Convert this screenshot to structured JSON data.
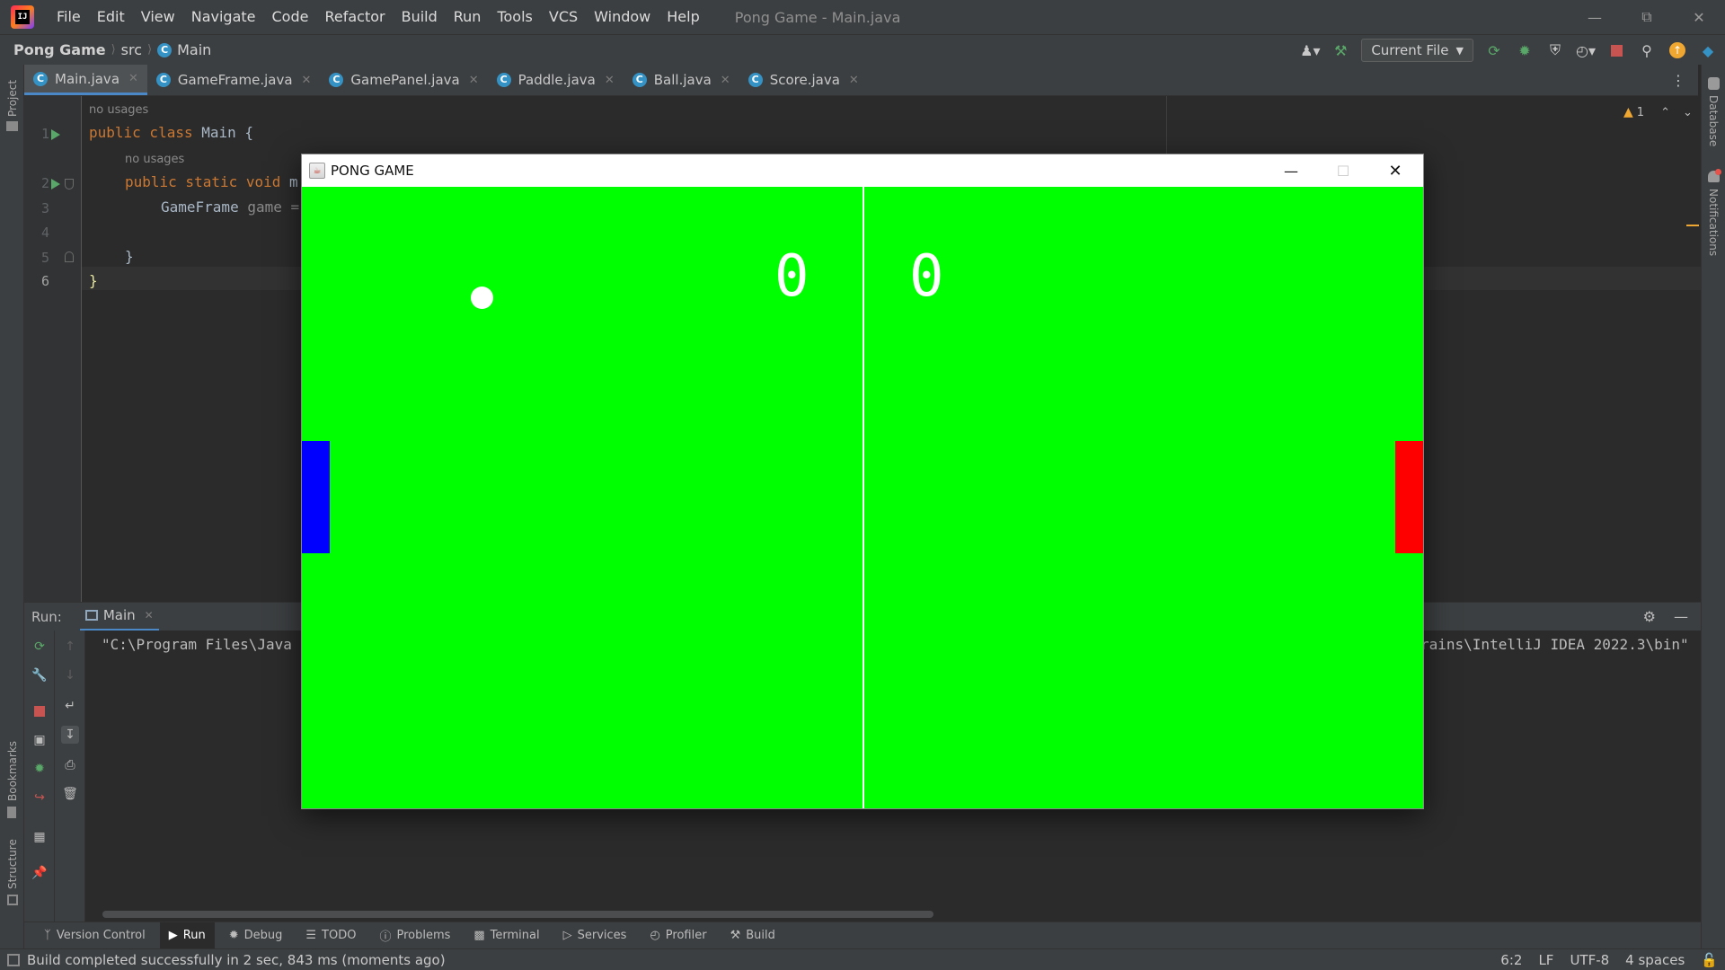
{
  "titlebar": {
    "menu": [
      "File",
      "Edit",
      "View",
      "Navigate",
      "Code",
      "Refactor",
      "Build",
      "Run",
      "Tools",
      "VCS",
      "Window",
      "Help"
    ],
    "window_title": "Pong Game - Main.java"
  },
  "navbar": {
    "project": "Pong Game",
    "folder": "src",
    "class": "Main",
    "run_config": "Current File"
  },
  "tabs": [
    {
      "label": "Main.java",
      "active": true
    },
    {
      "label": "GameFrame.java",
      "active": false
    },
    {
      "label": "GamePanel.java",
      "active": false
    },
    {
      "label": "Paddle.java",
      "active": false
    },
    {
      "label": "Ball.java",
      "active": false
    },
    {
      "label": "Score.java",
      "active": false
    }
  ],
  "side_labels": {
    "project": "Project",
    "bookmarks": "Bookmarks",
    "structure": "Structure",
    "database": "Database",
    "notifications": "Notifications"
  },
  "editor": {
    "hint_class": "no usages",
    "hint_method": "no usages",
    "line_numbers": [
      "1",
      "2",
      "3",
      "4",
      "5",
      "6"
    ],
    "warning_count": "1",
    "lines": {
      "l1_kw": "public class",
      "l1_rest": " Main {",
      "l2_kw": "public static void",
      "l2_rest": " m",
      "l3_type": "GameFrame",
      "l3_rest": " game =",
      "l5": "}",
      "l6": "}"
    }
  },
  "run_panel": {
    "label": "Run:",
    "tab": "Main",
    "console_left": "\"C:\\Program Files\\Java",
    "console_right": "rains\\IntelliJ IDEA 2022.3\\bin\""
  },
  "bottom_tabs": [
    {
      "label": "Version Control",
      "icon": "branch-icon",
      "active": false
    },
    {
      "label": "Run",
      "icon": "play-icon",
      "active": true
    },
    {
      "label": "Debug",
      "icon": "bug-icon",
      "active": false
    },
    {
      "label": "TODO",
      "icon": "list-icon",
      "active": false
    },
    {
      "label": "Problems",
      "icon": "info-icon",
      "active": false
    },
    {
      "label": "Terminal",
      "icon": "terminal-icon",
      "active": false
    },
    {
      "label": "Services",
      "icon": "services-icon",
      "active": false
    },
    {
      "label": "Profiler",
      "icon": "profiler-icon",
      "active": false
    },
    {
      "label": "Build",
      "icon": "hammer-icon",
      "active": false
    }
  ],
  "statusbar": {
    "message": "Build completed successfully in 2 sec, 843 ms (moments ago)",
    "position": "6:2",
    "line_sep": "LF",
    "encoding": "UTF-8",
    "indent": "4 spaces"
  },
  "pong": {
    "title": "PONG GAME",
    "score_left": "0",
    "score_right": "0",
    "colors": {
      "field": "#00ff00",
      "left_paddle": "#0000ff",
      "right_paddle": "#ff0000",
      "ball": "#ffffff"
    }
  },
  "colors": {
    "ide_bg": "#2b2b2b",
    "ide_panel": "#3c3f41",
    "keyword": "#cc7832",
    "accent": "#4a88c7",
    "run_green": "#59a869"
  }
}
